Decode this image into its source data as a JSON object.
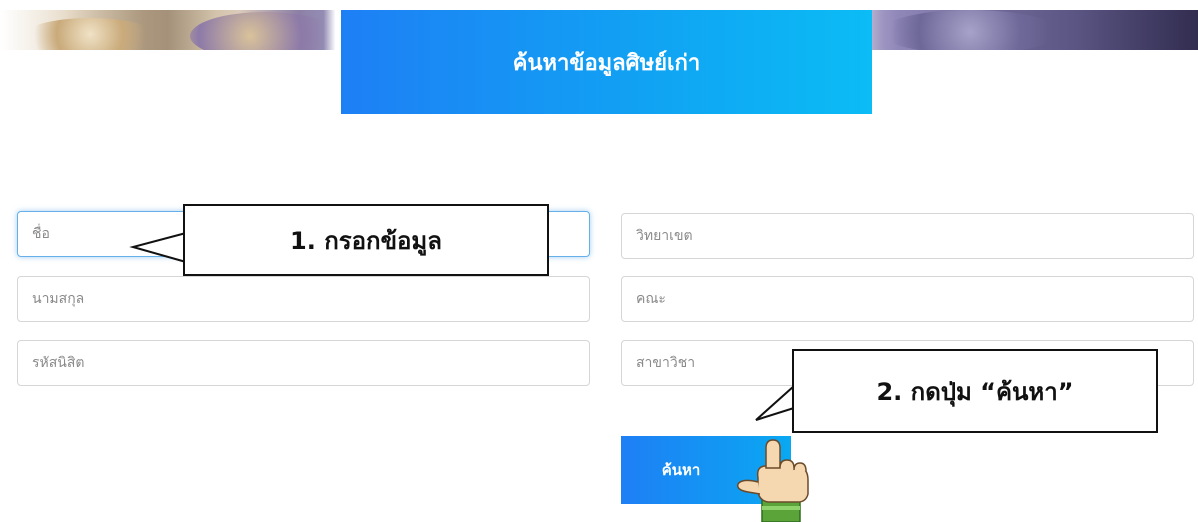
{
  "header": {
    "title": "ค้นหาข้อมูลศิษย์เก่า"
  },
  "form": {
    "left": [
      {
        "placeholder": "ชื่อ"
      },
      {
        "placeholder": "นามสกุล"
      },
      {
        "placeholder": "รหัสนิสิต"
      }
    ],
    "right": [
      {
        "placeholder": "วิทยาเขต"
      },
      {
        "placeholder": "คณะ"
      },
      {
        "placeholder": "สาขาวิชา"
      }
    ],
    "search_label": "ค้นหา"
  },
  "annotations": {
    "step1": "1. กรอกข้อมูล",
    "step2": "2. กดปุ่ม “ค้นหา”"
  },
  "colors": {
    "accent_blue": "#1e7ff5",
    "accent_cyan": "#0bbcf5",
    "focus_border": "#66afe9"
  },
  "icons": {
    "hand": "pointing-hand-icon"
  }
}
